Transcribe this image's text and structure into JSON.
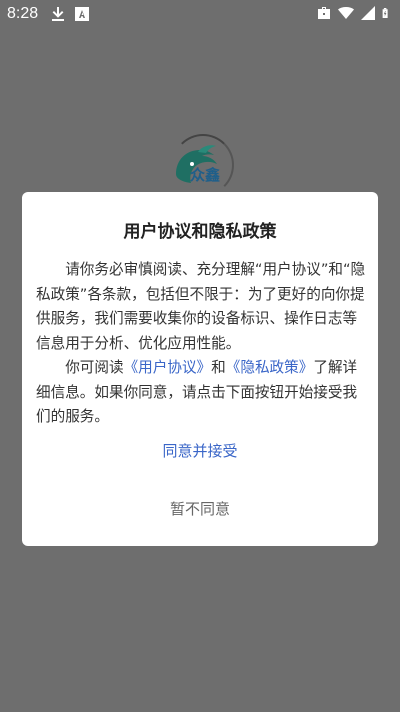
{
  "status_bar": {
    "time": "8:28",
    "left_icons": [
      "download-icon",
      "font-a-icon"
    ],
    "right_icons": [
      "briefcase-icon",
      "wifi-icon",
      "signal-icon",
      "battery-icon"
    ]
  },
  "splash": {
    "logo_text": "众鑫"
  },
  "dialog": {
    "title": "用户协议和隐私政策",
    "paragraph1": "请你务必审慎阅读、充分理解“用户协议”和“隐私政策”各条款，包括但不限于：为了更好的向你提供服务，我们需要收集你的设备标识、操作日志等信息用于分析、优化应用性能。",
    "p2_prefix": "你可阅读",
    "user_agreement_link": "《用户协议》",
    "p2_and": "和",
    "privacy_policy_link": "《隐私政策》",
    "p2_suffix": "了解详细信息。如果你同意，请点击下面按钮开始接受我们的服务。",
    "accept_label": "同意并接受",
    "decline_label": "暂不同意"
  },
  "colors": {
    "overlay": "#6e6e6e",
    "link": "#3a66c8",
    "dialog_bg": "#ffffff"
  }
}
